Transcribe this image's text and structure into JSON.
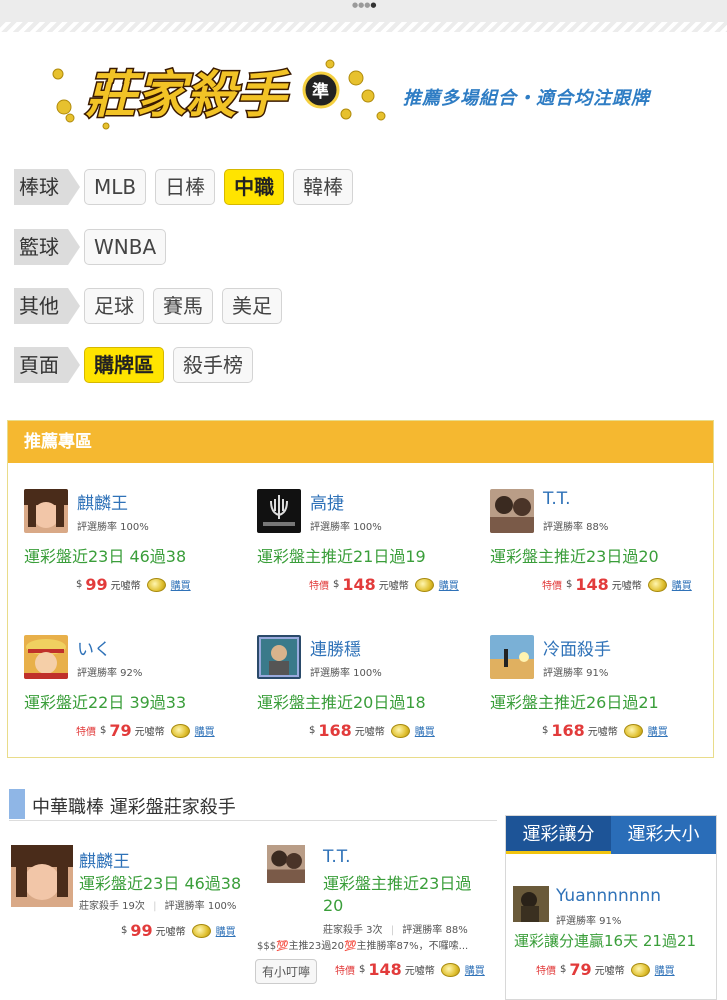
{
  "header": {
    "logo_text": "莊家殺手",
    "logo_badge": "準",
    "slogan": "推薦多場組合・適合均注跟牌"
  },
  "categories": [
    {
      "label": "棒球",
      "tags": [
        {
          "label": "MLB",
          "active": false
        },
        {
          "label": "日棒",
          "active": false
        },
        {
          "label": "中職",
          "active": true
        },
        {
          "label": "韓棒",
          "active": false
        }
      ]
    },
    {
      "label": "籃球",
      "tags": [
        {
          "label": "WNBA",
          "active": false
        }
      ]
    },
    {
      "label": "其他",
      "tags": [
        {
          "label": "足球",
          "active": false
        },
        {
          "label": "賽馬",
          "active": false
        },
        {
          "label": "美足",
          "active": false
        }
      ]
    },
    {
      "label": "頁面",
      "tags": [
        {
          "label": "購牌區",
          "active": true
        },
        {
          "label": "殺手榜",
          "active": false
        }
      ]
    }
  ],
  "recommend": {
    "title": "推薦專區",
    "currency": "$",
    "unit": "元噓幣",
    "buy": "購買",
    "special": "特價",
    "cards": [
      {
        "name": "麒麟王",
        "rate": "評選勝率 100%",
        "streak": "運彩盤近23日 46過38",
        "special": false,
        "price": "99"
      },
      {
        "name": "高捷",
        "rate": "評選勝率 100%",
        "streak": "運彩盤主推近21日過19",
        "special": true,
        "price": "148"
      },
      {
        "name": "T.T.",
        "rate": "評選勝率 88%",
        "streak": "運彩盤主推近23日過20",
        "special": true,
        "price": "148"
      },
      {
        "name": "いく",
        "rate": "評選勝率 92%",
        "streak": "運彩盤近22日 39過33",
        "special": true,
        "price": "79"
      },
      {
        "name": "連勝穩",
        "rate": "評選勝率 100%",
        "streak": "運彩盤主推近20日過18",
        "special": false,
        "price": "168"
      },
      {
        "name": "冷面殺手",
        "rate": "評選勝率 91%",
        "streak": "運彩盤主推近26日過21",
        "special": false,
        "price": "168"
      }
    ]
  },
  "section": {
    "title": "中華職棒  運彩盤莊家殺手",
    "cards": [
      {
        "name": "麒麟王",
        "streak": "運彩盤近23日 46過38",
        "count": "莊家殺手 19次",
        "rate": "評選勝率 100%",
        "price": "99",
        "special": false
      },
      {
        "name": "T.T.",
        "streak": "運彩盤主推近23日過20",
        "count": "莊家殺手 3次",
        "rate": "評選勝率 88%",
        "desc": "$$$💯主推23過20💯主推勝率87%，不囉嗦...",
        "price": "148",
        "special": true,
        "button": "有小叮嚀"
      }
    ]
  },
  "panel": {
    "tabs": [
      "運彩讓分",
      "運彩大小"
    ],
    "card": {
      "name": "Yuannnnnnn",
      "rate": "評選勝率 91%",
      "streak": "運彩讓分連贏16天 21過21",
      "price": "79",
      "special": true
    }
  }
}
